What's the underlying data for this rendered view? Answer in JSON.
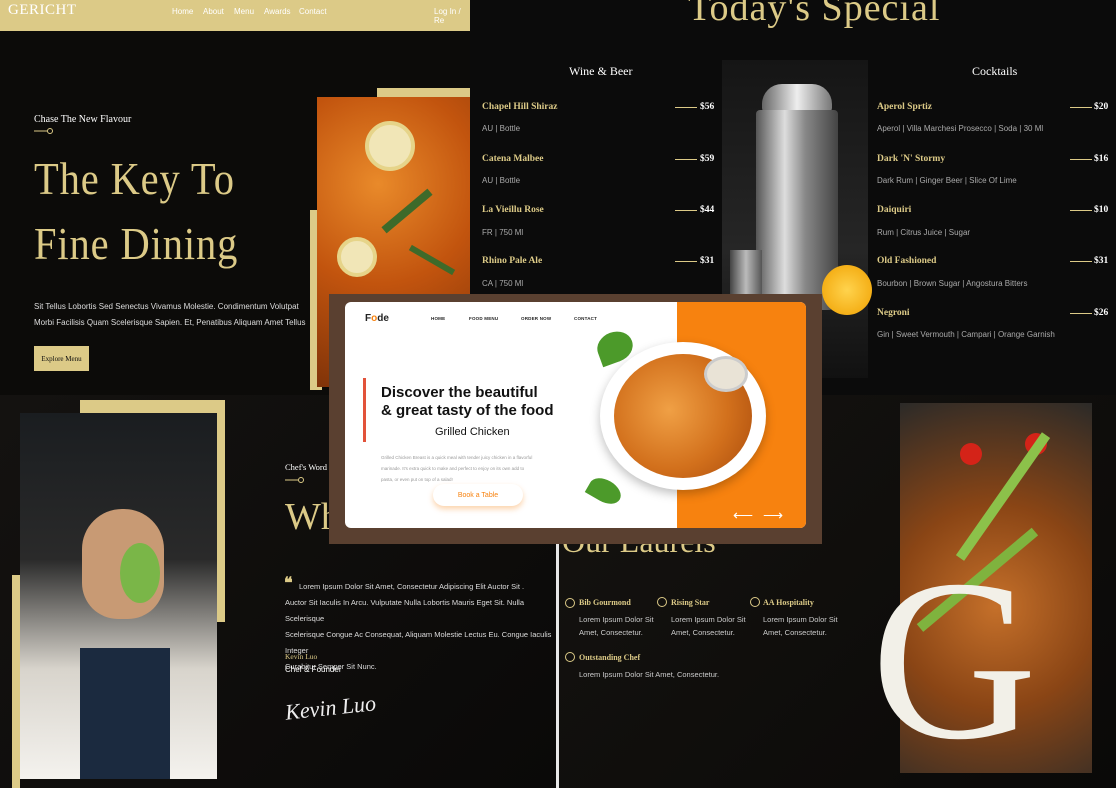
{
  "gericht": {
    "logo": "GERICHT",
    "nav": [
      "Home",
      "About",
      "Menu",
      "Awards",
      "Contact"
    ],
    "login": "Log In / Re",
    "hero": {
      "subtitle": "Chase The New Flavour",
      "title_line1": "The Key To",
      "title_line2": "Fine Dining",
      "paragraph_line1": "Sit Tellus Lobortis Sed Senectus Vivamus Molestie. Condimentum Volutpat",
      "paragraph_line2": "Morbi Facilisis Quam Scelerisque Sapien. Et, Penatibus Aliquam Amet Tellus",
      "button": "Explore Menu"
    }
  },
  "special": {
    "heading": "Today's Special",
    "wine_title": "Wine & Beer",
    "cocktail_title": "Cocktails",
    "wine": [
      {
        "name": "Chapel Hill Shiraz",
        "desc": "AU | Bottle",
        "price": "$56"
      },
      {
        "name": "Catena Malbee",
        "desc": "AU | Bottle",
        "price": "$59"
      },
      {
        "name": "La Vieillu Rose",
        "desc": "FR | 750 Ml",
        "price": "$44"
      },
      {
        "name": "Rhino Pale Ale",
        "desc": "CA | 750 Ml",
        "price": "$31"
      }
    ],
    "cocktails": [
      {
        "name": "Aperol Sprtiz",
        "desc": "Aperol | Villa Marchesi Prosecco | Soda | 30 Ml",
        "price": "$20"
      },
      {
        "name": "Dark 'N' Stormy",
        "desc": "Dark Rum | Ginger Beer | Slice Of Lime",
        "price": "$16"
      },
      {
        "name": "Daiquiri",
        "desc": "Rum | Citrus Juice | Sugar",
        "price": "$10"
      },
      {
        "name": "Old Fashioned",
        "desc": "Bourbon | Brown Sugar | Angostura Bitters",
        "price": "$31"
      },
      {
        "name": "Negroni",
        "desc": "Gin | Sweet Vermouth | Campari | Orange Garnish",
        "price": "$26"
      }
    ]
  },
  "chef": {
    "subtitle": "Chef's Word",
    "heading": "Wha",
    "quote_line1": "Lorem Ipsum Dolor Sit Amet, Consectetur Adipiscing Elit Auctor Sit .",
    "quote_line2": "Auctor Sit Iaculis In Arcu. Vulputate Nulla Lobortis Mauris Eget Sit. Nulla Scelerisque",
    "quote_line3": "Scelerisque Congue Ac Consequat, Aliquam Molestie Lectus Eu. Congue Iaculis Integer",
    "quote_line4": "Curabitur Semper Sit Nunc.",
    "name": "Kevin Luo",
    "role": "Chef & Founder",
    "signature": "Kevin Luo"
  },
  "laurels": {
    "heading": "Our Laurels",
    "items": [
      {
        "name": "Bib Gourmond",
        "desc1": "Lorem Ipsum Dolor Sit",
        "desc2": "Amet, Consectetur."
      },
      {
        "name": "Rising Star",
        "desc1": "Lorem Ipsum Dolor Sit",
        "desc2": "Amet, Consectetur."
      },
      {
        "name": "AA Hospitality",
        "desc1": "Lorem Ipsum Dolor Sit",
        "desc2": "Amet, Consectetur."
      },
      {
        "name": "Outstanding Chef",
        "desc1": "Lorem Ipsum Dolor Sit Amet, Consectetur.",
        "desc2": ""
      }
    ],
    "watermark": "G"
  },
  "fode": {
    "logo_f": "F",
    "logo_o": "o",
    "logo_de": "de",
    "nav": [
      "HOME",
      "FOOD MENU",
      "ORDER NOW",
      "CONTACT"
    ],
    "title_line1": "Discover the beautiful",
    "title_line2": "& great tasty of the food",
    "dish": "Grilled Chicken",
    "desc_line1": "Grilled Chicken Breast is a quick meal with tender juicy chicken in a flavorful",
    "desc_line2": "marinade. It's extra quick to make and perfect to enjoy on its own add to",
    "desc_line3": "pasta, or even put on top of a salad!",
    "button": "Book a Table",
    "arrow_prev": "⟵",
    "arrow_next": "⟶"
  },
  "colors": {
    "gold": "#dcca87",
    "orange": "#f7820f",
    "dark": "#0c0c0c"
  }
}
